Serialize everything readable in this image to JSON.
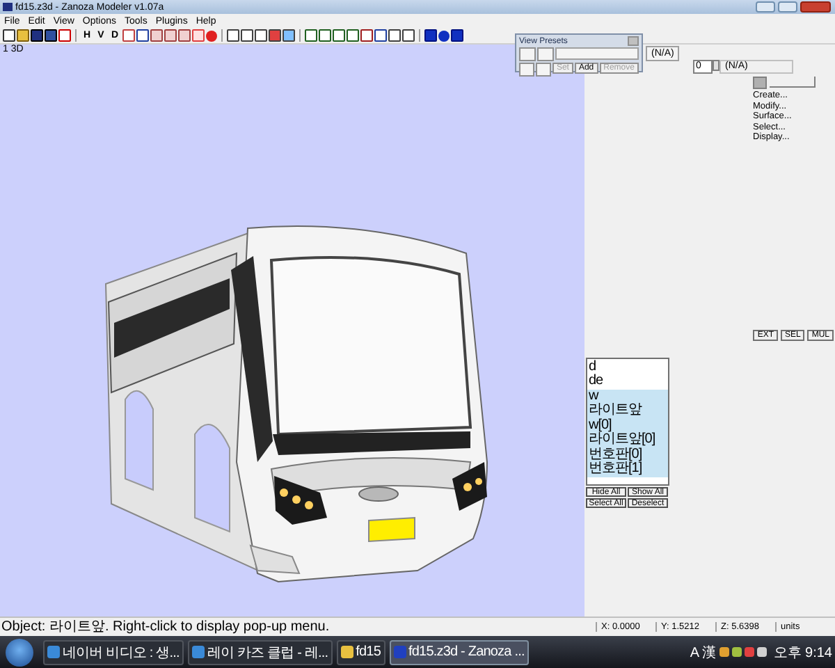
{
  "window": {
    "title": "fd15.z3d - Zanoza Modeler v1.07a"
  },
  "menu": [
    "File",
    "Edit",
    "View",
    "Options",
    "Tools",
    "Plugins",
    "Help"
  ],
  "toolbar": {
    "view_buttons": [
      "H",
      "V",
      "D"
    ]
  },
  "viewport": {
    "label": "1 3D"
  },
  "view_presets": {
    "title": "View Presets",
    "buttons": [
      {
        "label": "Set",
        "disabled": true
      },
      {
        "label": "Add",
        "disabled": false
      },
      {
        "label": "Remove",
        "disabled": true
      }
    ]
  },
  "panel": {
    "field_top": "(N/A)",
    "spinner": {
      "value": "0",
      "text": "(N/A)"
    },
    "actions": [
      "Create...",
      "Modify...",
      "Surface...",
      "Select...",
      "Display..."
    ],
    "mode_buttons": [
      "EXT",
      "SEL",
      "MUL"
    ],
    "objects": [
      {
        "name": "d",
        "selected": false
      },
      {
        "name": "de",
        "selected": false
      },
      {
        "name": "w",
        "selected": true
      },
      {
        "name": "라이트앞",
        "selected": true
      },
      {
        "name": "w[0]",
        "selected": true
      },
      {
        "name": "라이트앞[0]",
        "selected": true
      },
      {
        "name": "번호판[0]",
        "selected": true
      },
      {
        "name": "번호판[1]",
        "selected": true
      }
    ],
    "list_buttons": [
      "Hide All",
      "Show All",
      "Select All",
      "Deselect"
    ]
  },
  "status_bar": {
    "message": "Object: 라이트앞. Right-click to display pop-up menu.",
    "x": "X: 0.0000",
    "y": "Y: 1.5212",
    "z": "Z: 5.6398",
    "units": "units"
  },
  "taskbar": {
    "tasks": [
      {
        "label": "네이버 비디오 : 생...",
        "kind": "browser",
        "selected": false
      },
      {
        "label": "레이 카즈 클럽 - 레...",
        "kind": "browser",
        "selected": false
      },
      {
        "label": "fd15",
        "kind": "folder",
        "selected": false
      },
      {
        "label": "fd15.z3d - Zanoza ...",
        "kind": "app",
        "selected": true
      }
    ],
    "ime": "A 漢",
    "clock": "오후 9:14"
  }
}
